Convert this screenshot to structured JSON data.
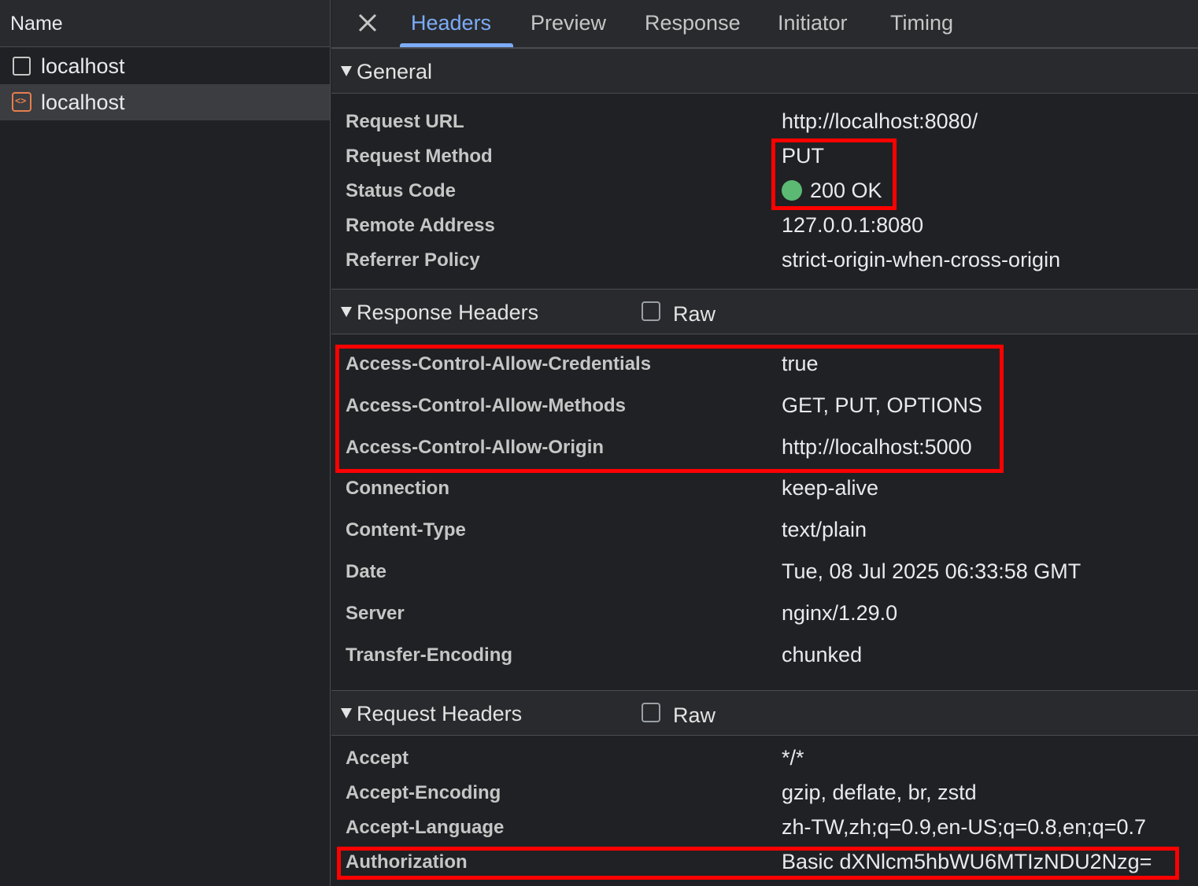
{
  "left_panel": {
    "header": "Name",
    "requests": [
      {
        "label": "localhost",
        "icon": "document-icon"
      },
      {
        "label": "localhost",
        "icon": "fetch-xhr-icon"
      }
    ]
  },
  "tabs": [
    "Headers",
    "Preview",
    "Response",
    "Initiator",
    "Timing"
  ],
  "general": {
    "title": "General",
    "rows": [
      {
        "key": "Request URL",
        "value": "http://localhost:8080/"
      },
      {
        "key": "Request Method",
        "value": "PUT"
      },
      {
        "key": "Status Code",
        "value": "200 OK"
      },
      {
        "key": "Remote Address",
        "value": "127.0.0.1:8080"
      },
      {
        "key": "Referrer Policy",
        "value": "strict-origin-when-cross-origin"
      }
    ]
  },
  "response_headers": {
    "title": "Response Headers",
    "raw_label": "Raw",
    "rows": [
      {
        "key": "Access-Control-Allow-Credentials",
        "value": "true"
      },
      {
        "key": "Access-Control-Allow-Methods",
        "value": "GET, PUT, OPTIONS"
      },
      {
        "key": "Access-Control-Allow-Origin",
        "value": "http://localhost:5000"
      },
      {
        "key": "Connection",
        "value": "keep-alive"
      },
      {
        "key": "Content-Type",
        "value": "text/plain"
      },
      {
        "key": "Date",
        "value": "Tue, 08 Jul 2025 06:33:58 GMT"
      },
      {
        "key": "Server",
        "value": "nginx/1.29.0"
      },
      {
        "key": "Transfer-Encoding",
        "value": "chunked"
      }
    ]
  },
  "request_headers": {
    "title": "Request Headers",
    "raw_label": "Raw",
    "rows": [
      {
        "key": "Accept",
        "value": "*/*"
      },
      {
        "key": "Accept-Encoding",
        "value": "gzip, deflate, br, zstd"
      },
      {
        "key": "Accept-Language",
        "value": "zh-TW,zh;q=0.9,en-US;q=0.8,en;q=0.7"
      },
      {
        "key": "Authorization",
        "value": "Basic dXNlcm5hbWU6MTIzNDU2Nzg="
      }
    ]
  },
  "colors": {
    "highlight": "#ff0000",
    "status_ok": "#5bb974",
    "active_tab": "#7cacf8"
  }
}
